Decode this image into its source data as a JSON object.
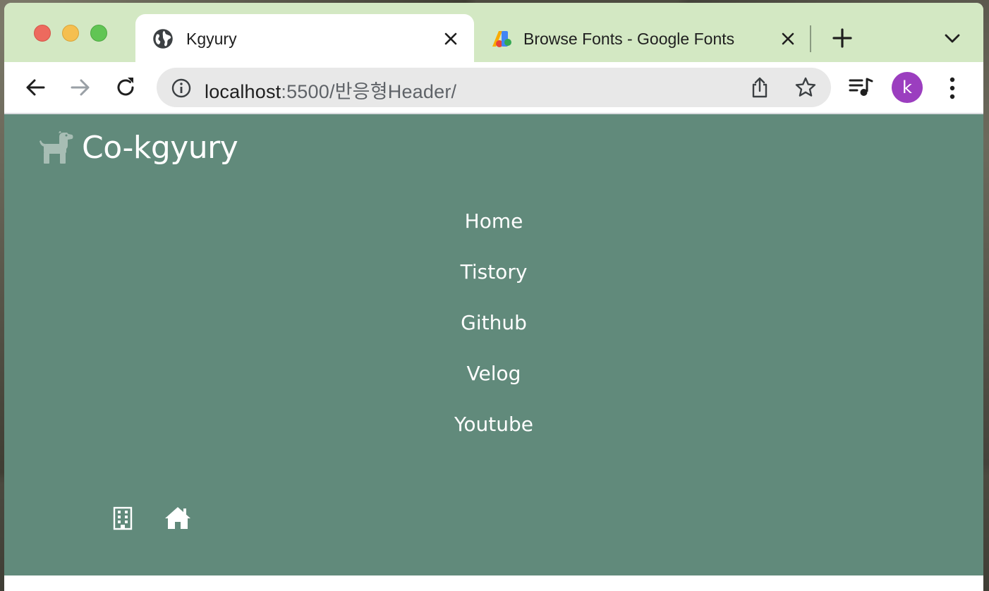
{
  "browser": {
    "tabs": [
      {
        "title": "Kgyury",
        "icon": "globe-icon",
        "active": true
      },
      {
        "title": "Browse Fonts - Google Fonts",
        "icon": "google-fonts-icon",
        "active": false
      }
    ],
    "address": {
      "host": "localhost",
      "rest": ":5500/반응형Header/"
    },
    "profile_initial": "k"
  },
  "site": {
    "logo": {
      "icon": "dog-icon",
      "text": "Co-kgyury"
    },
    "nav": [
      "Home",
      "Tistory",
      "Github",
      "Velog",
      "Youtube"
    ],
    "footer_icons": [
      "building-icon",
      "home-icon"
    ],
    "colors": {
      "background": "#618a7b",
      "text": "#ffffff",
      "tab_strip": "#d3e8c3"
    }
  }
}
